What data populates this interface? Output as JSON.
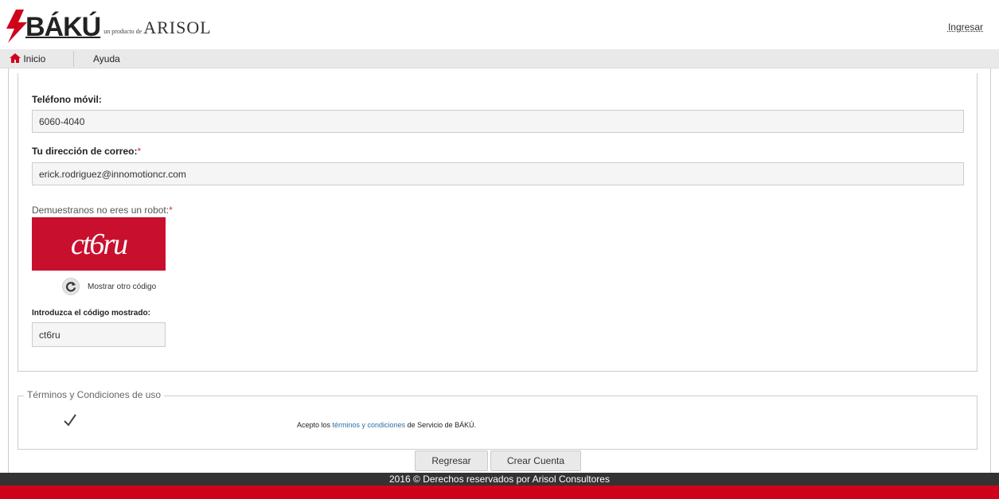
{
  "header": {
    "brand": "BÁKÚ",
    "byline": "un producto de",
    "company": "ARISOL",
    "login_link": "Ingresar",
    "colors": {
      "accent_red": "#d0021b",
      "footer_dark": "#333333"
    }
  },
  "nav": {
    "items": [
      {
        "label": "Inicio",
        "icon": "home-icon"
      },
      {
        "label": "Ayuda"
      }
    ]
  },
  "form": {
    "mobile_label": "Teléfono móvil:",
    "mobile_value": "6060-4040",
    "email_label": "Tu dirección de correo:",
    "email_value": "erick.rodriguez@innomotioncr.com",
    "required_mark": "*",
    "robot_label": "Demuestranos no eres un robot:",
    "captcha_text": "ct6ru",
    "refresh_label": "Mostrar otro código",
    "code_label": "Introduzca el código mostrado:",
    "code_value": "ct6ru"
  },
  "terms": {
    "legend": "Términos y Condiciones de uso",
    "checked": true,
    "prefix": "Acepto los ",
    "link": "términos y condiciones",
    "suffix": " de Servicio de BÁKÚ."
  },
  "buttons": {
    "back": "Regresar",
    "create": "Crear Cuenta"
  },
  "footer": {
    "text": "2016 © Derechos reservados por Arisol Consultores"
  }
}
